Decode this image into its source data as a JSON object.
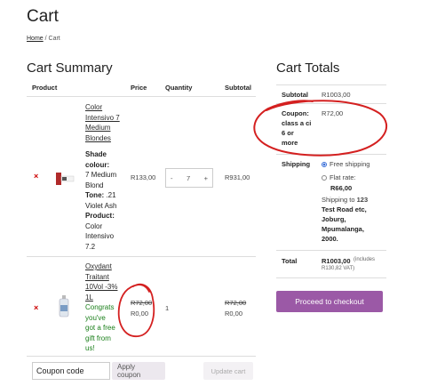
{
  "page": {
    "title": "Cart"
  },
  "breadcrumb": {
    "home": "Home",
    "sep": " / ",
    "current": "Cart"
  },
  "summary": {
    "heading": "Cart Summary",
    "columns": {
      "product": "Product",
      "price": "Price",
      "quantity": "Quantity",
      "subtotal": "Subtotal"
    },
    "items": [
      {
        "remove": "×",
        "name_lines": [
          "Color",
          "Intensivo 7",
          "Medium",
          "Blondes"
        ],
        "shade_label": "Shade",
        "shade_label2": "colour:",
        "shade_lines": [
          "7 Medium",
          "Blond"
        ],
        "tone_label": "Tone:",
        "tone_value": ".21",
        "tone_lines": [
          "Violet Ash"
        ],
        "product_label": "Product:",
        "product_lines": [
          "Color",
          "Intensivo",
          "7.2"
        ],
        "price": "R133,00",
        "qty_minus": "-",
        "qty": "7",
        "qty_plus": "+",
        "subtotal": "R931,00"
      },
      {
        "remove": "×",
        "name_lines": [
          "Oxydant",
          "Traitant",
          "10Vol -3%",
          "1L"
        ],
        "promo_lines": [
          "Congrats",
          "you've",
          "got a free",
          "gift from",
          "us!"
        ],
        "price_old": "R72,00",
        "price_new": "R0,00",
        "qty": "1",
        "subtotal_old": "R72,00",
        "subtotal_new": "R0,00"
      }
    ],
    "coupon": {
      "placeholder": "Coupon code",
      "apply": "Apply coupon",
      "update": "Update cart"
    }
  },
  "totals": {
    "heading": "Cart Totals",
    "subtotal_label": "Subtotal",
    "subtotal_value": "R1003,00",
    "coupon_lines": [
      "Coupon:",
      "class a ci",
      "6 or",
      "more"
    ],
    "coupon_value": "R72,00",
    "shipping_label": "Shipping",
    "shipping_options": [
      "Free shipping",
      "Flat rate:"
    ],
    "flat_rate_value": "R66,00",
    "shipping_to": "Shipping to",
    "address_lines": [
      "123",
      "Test Road etc,",
      "Joburg,",
      "Mpumalanga,",
      "2000."
    ],
    "total_label": "Total",
    "total_value": "R1003,00",
    "total_includes": "(includes",
    "total_vat": "R130,82 VAT)",
    "checkout": "Proceed to checkout"
  },
  "colors": {
    "accent": "#9b59a6",
    "remove": "#cc0000",
    "promo": "#1a7f1a",
    "annotation": "#d42020"
  },
  "icons": [
    "remove-icon",
    "product-image",
    "radio"
  ]
}
